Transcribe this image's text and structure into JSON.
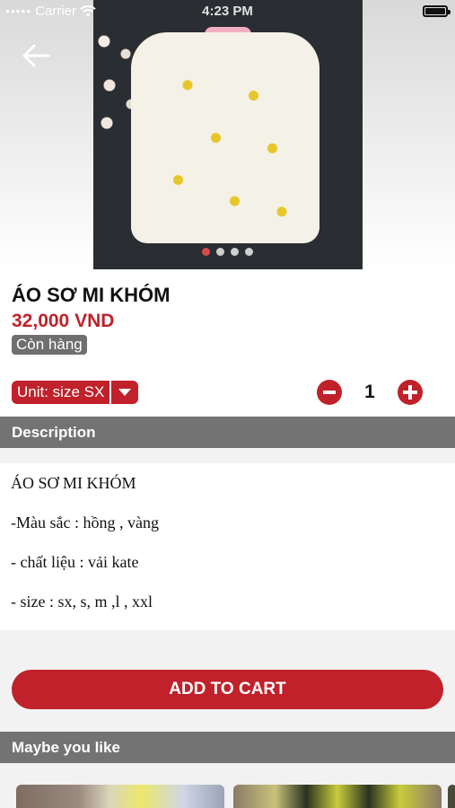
{
  "status_bar": {
    "carrier": "Carrier",
    "time": "4:23 PM"
  },
  "product": {
    "title": "ÁO SƠ MI KHÓM",
    "price": "32,000 VND",
    "stock_status": "Còn hàng",
    "unit_label": "Unit: size SX",
    "quantity": "1",
    "image_count": 4,
    "active_image_index": 0
  },
  "description": {
    "header": "Description",
    "lines": [
      "ÁO SƠ MI KHÓM",
      "-Màu sắc : hồng , vàng",
      "- chất liệu : vải kate",
      "- size : sx, s, m ,l , xxl"
    ]
  },
  "actions": {
    "add_to_cart": "ADD TO CART"
  },
  "related": {
    "header": "Maybe you like"
  },
  "colors": {
    "accent": "#c0212a",
    "section_bar": "#737373",
    "badge": "#6f6f6f"
  },
  "icons": {
    "back": "arrow-left-icon",
    "dropdown": "caret-down-icon",
    "minus": "minus-circle-icon",
    "plus": "plus-circle-icon",
    "wifi": "wifi-icon",
    "battery": "battery-icon"
  }
}
